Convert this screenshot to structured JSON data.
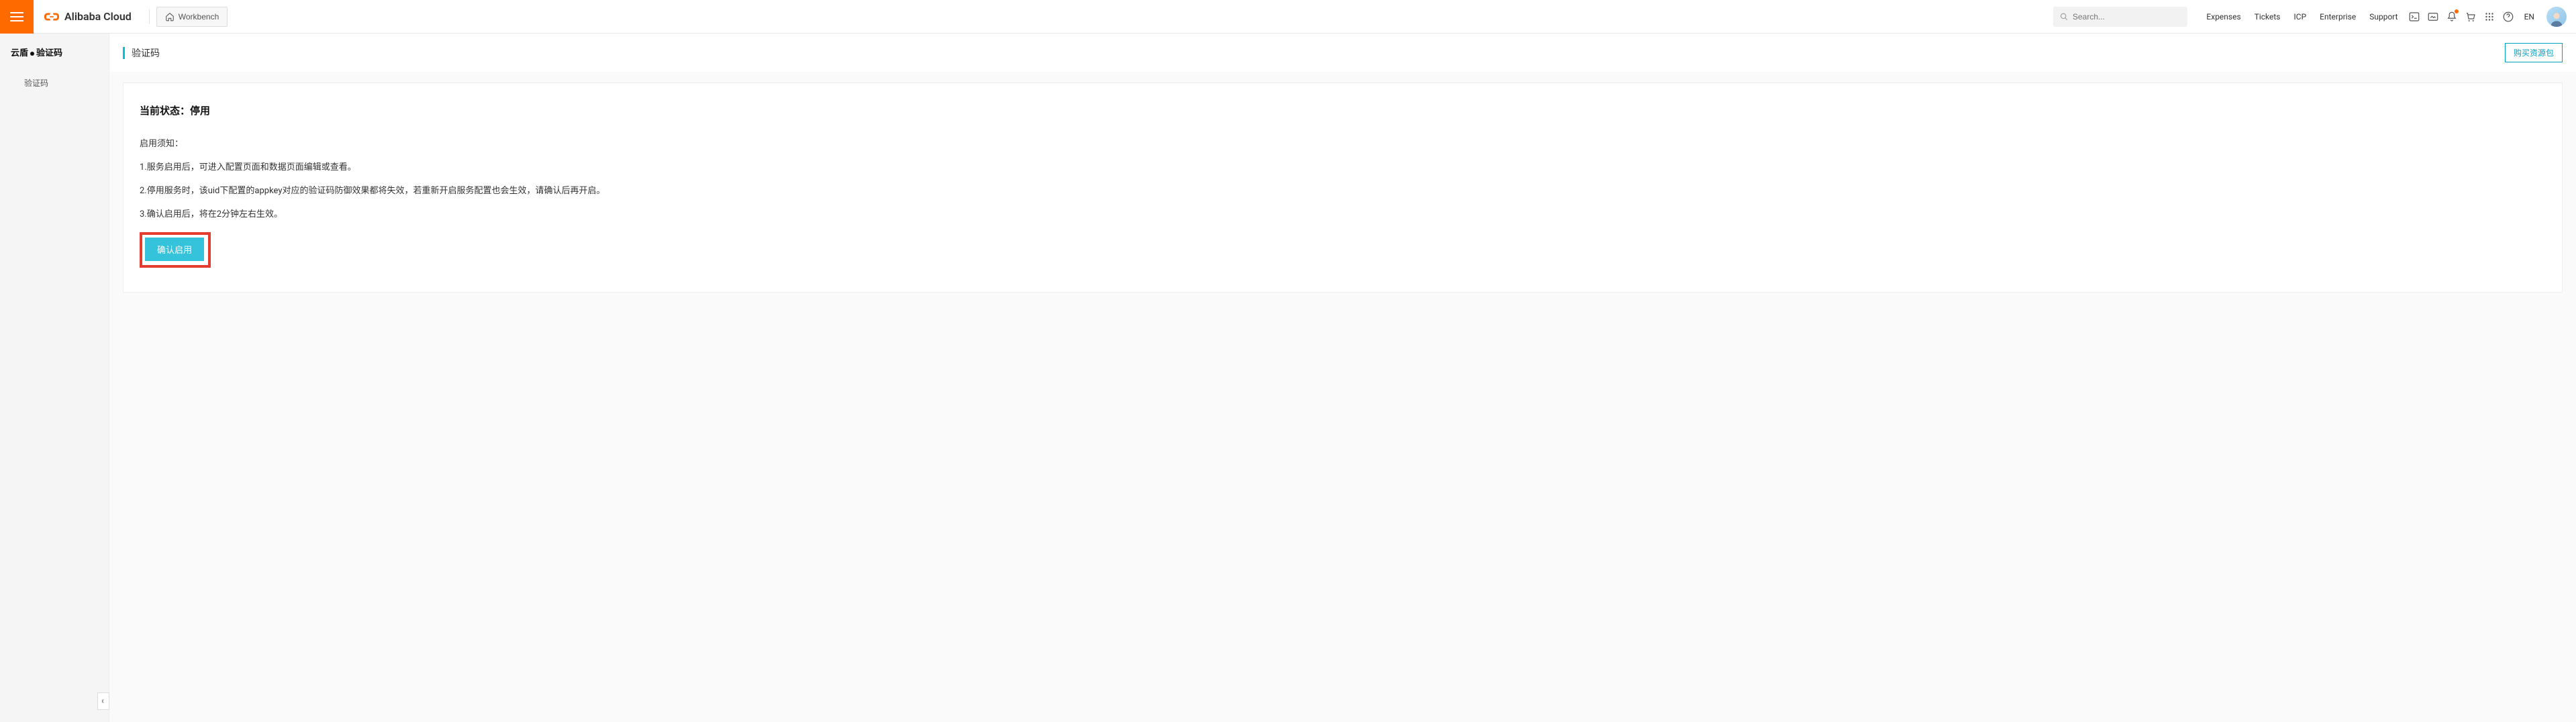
{
  "header": {
    "brand": "Alibaba Cloud",
    "workbench": "Workbench",
    "search_placeholder": "Search...",
    "nav": {
      "expenses": "Expenses",
      "tickets": "Tickets",
      "icp": "ICP",
      "enterprise": "Enterprise",
      "support": "Support"
    },
    "lang": "EN"
  },
  "sidebar": {
    "title_prefix": "云盾",
    "title_suffix": "验证码",
    "item_captcha": "验证码"
  },
  "page": {
    "title": "验证码",
    "buy_button": "购买资源包",
    "status_label": "当前状态：",
    "status_value": "停用",
    "notice_heading": "启用须知：",
    "notice_1": "1.服务启用后，可进入配置页面和数据页面编辑或查看。",
    "notice_2": "2.停用服务时，该uid下配置的appkey对应的验证码防御效果都将失效，若重新开启服务配置也会生效，请确认后再开启。",
    "notice_3": "3.确认启用后，将在2分钟左右生效。",
    "enable_button": "确认启用"
  }
}
